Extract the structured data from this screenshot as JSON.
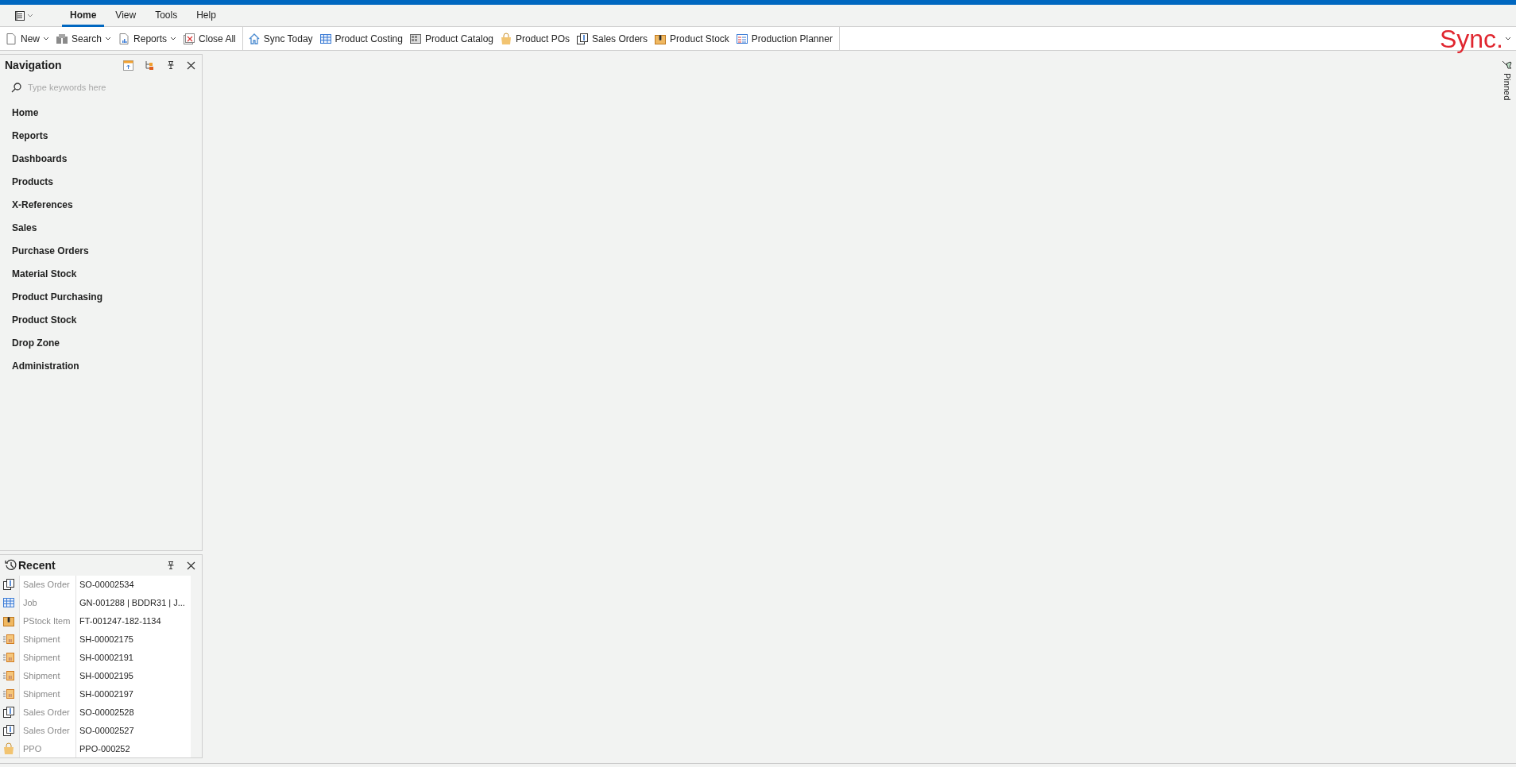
{
  "menu": {
    "tabs": [
      {
        "label": "Home",
        "selected": true
      },
      {
        "label": "View",
        "selected": false
      },
      {
        "label": "Tools",
        "selected": false
      },
      {
        "label": "Help",
        "selected": false
      }
    ]
  },
  "toolbar": {
    "groups": [
      [
        {
          "label": "New",
          "kind": "new",
          "dropdown": true
        },
        {
          "label": "Search",
          "kind": "search",
          "dropdown": true
        },
        {
          "label": "Reports",
          "kind": "reports",
          "dropdown": true
        },
        {
          "label": "Close All",
          "kind": "close-all",
          "dropdown": false
        }
      ],
      [
        {
          "label": "Sync Today",
          "kind": "home",
          "dropdown": false
        },
        {
          "label": "Product Costing",
          "kind": "grid",
          "dropdown": false
        },
        {
          "label": "Product Catalog",
          "kind": "catalog",
          "dropdown": false
        },
        {
          "label": "Product POs",
          "kind": "bag",
          "dropdown": false
        },
        {
          "label": "Sales Orders",
          "kind": "sales",
          "dropdown": false
        },
        {
          "label": "Product Stock",
          "kind": "box",
          "dropdown": false
        },
        {
          "label": "Production Planner",
          "kind": "planner",
          "dropdown": false
        }
      ]
    ],
    "logo": "Sync."
  },
  "navigation": {
    "title": "Navigation",
    "search": {
      "placeholder": "Type keywords here"
    },
    "items": [
      "Home",
      "Reports",
      "Dashboards",
      "Products",
      "X-References",
      "Sales",
      "Purchase Orders",
      "Material Stock",
      "Product Purchasing",
      "Product Stock",
      "Drop Zone",
      "Administration"
    ]
  },
  "recent": {
    "title": "Recent",
    "rows": [
      {
        "kind": "sales",
        "type": "Sales Order",
        "value": "SO-00002534"
      },
      {
        "kind": "grid",
        "type": "Job",
        "value": "GN-001288 |  BDDR31 | J..."
      },
      {
        "kind": "box",
        "type": "PStock Item",
        "value": "FT-001247-182-1134"
      },
      {
        "kind": "shipment",
        "type": "Shipment",
        "value": "SH-00002175"
      },
      {
        "kind": "shipment",
        "type": "Shipment",
        "value": "SH-00002191"
      },
      {
        "kind": "shipment",
        "type": "Shipment",
        "value": "SH-00002195"
      },
      {
        "kind": "shipment",
        "type": "Shipment",
        "value": "SH-00002197"
      },
      {
        "kind": "sales",
        "type": "Sales Order",
        "value": "SO-00002528"
      },
      {
        "kind": "sales",
        "type": "Sales Order",
        "value": "SO-00002527"
      },
      {
        "kind": "bag",
        "type": "PPO",
        "value": "PPO-000252"
      }
    ]
  },
  "side": {
    "pinned_label": "Pinned"
  }
}
